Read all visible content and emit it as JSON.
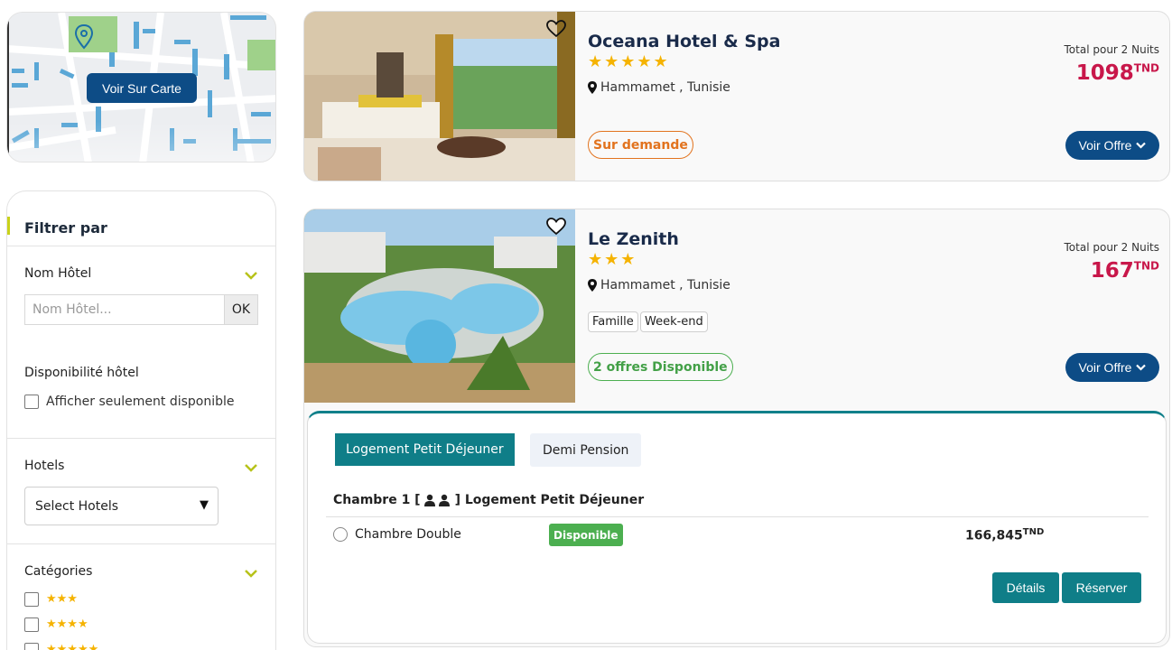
{
  "map": {
    "button_label": "Voir Sur Carte"
  },
  "filter": {
    "title": "Filtrer par",
    "hotel_name": {
      "label": "Nom Hôtel",
      "placeholder": "Nom Hôtel...",
      "ok_label": "OK"
    },
    "availability": {
      "label": "Disponibilité hôtel",
      "checkbox_label": "Afficher seulement disponible"
    },
    "hotels": {
      "label": "Hotels",
      "select_value": "Select Hotels"
    },
    "categories": {
      "label": "Catégories",
      "options": [
        "★★★",
        "★★★★",
        "★★★★★"
      ]
    }
  },
  "hotels": [
    {
      "name": "Oceana Hotel & Spa",
      "stars": "★★★★★",
      "location": "Hammamet , Tunisie",
      "total_label": "Total pour 2 Nuits",
      "price": "1098",
      "currency": "TND",
      "status": "Sur demande",
      "offer_button": "Voir Offre"
    },
    {
      "name": "Le Zenith",
      "stars": "★★★",
      "location": "Hammamet , Tunisie",
      "tags": [
        "Famille",
        "Week-end"
      ],
      "total_label": "Total pour 2 Nuits",
      "price": "167",
      "currency": "TND",
      "status": "2 offres Disponible",
      "offer_button": "Voir Offre"
    }
  ],
  "offers_panel": {
    "tabs": [
      "Logement Petit Déjeuner",
      "Demi Pension"
    ],
    "room_title_prefix": "Chambre 1 [",
    "room_title_suffix": "] Logement Petit Déjeuner",
    "room": {
      "name": "Chambre Double",
      "availability": "Disponible",
      "price": "166,845",
      "currency": "TND"
    },
    "details_button": "Détails",
    "book_button": "Réserver"
  },
  "colors": {
    "primary_blue": "#0d4c86",
    "teal": "#0f7e88",
    "price_red": "#c8174a",
    "star_gold": "#f5b301",
    "orange": "#e2731e",
    "green": "#4caf50"
  }
}
